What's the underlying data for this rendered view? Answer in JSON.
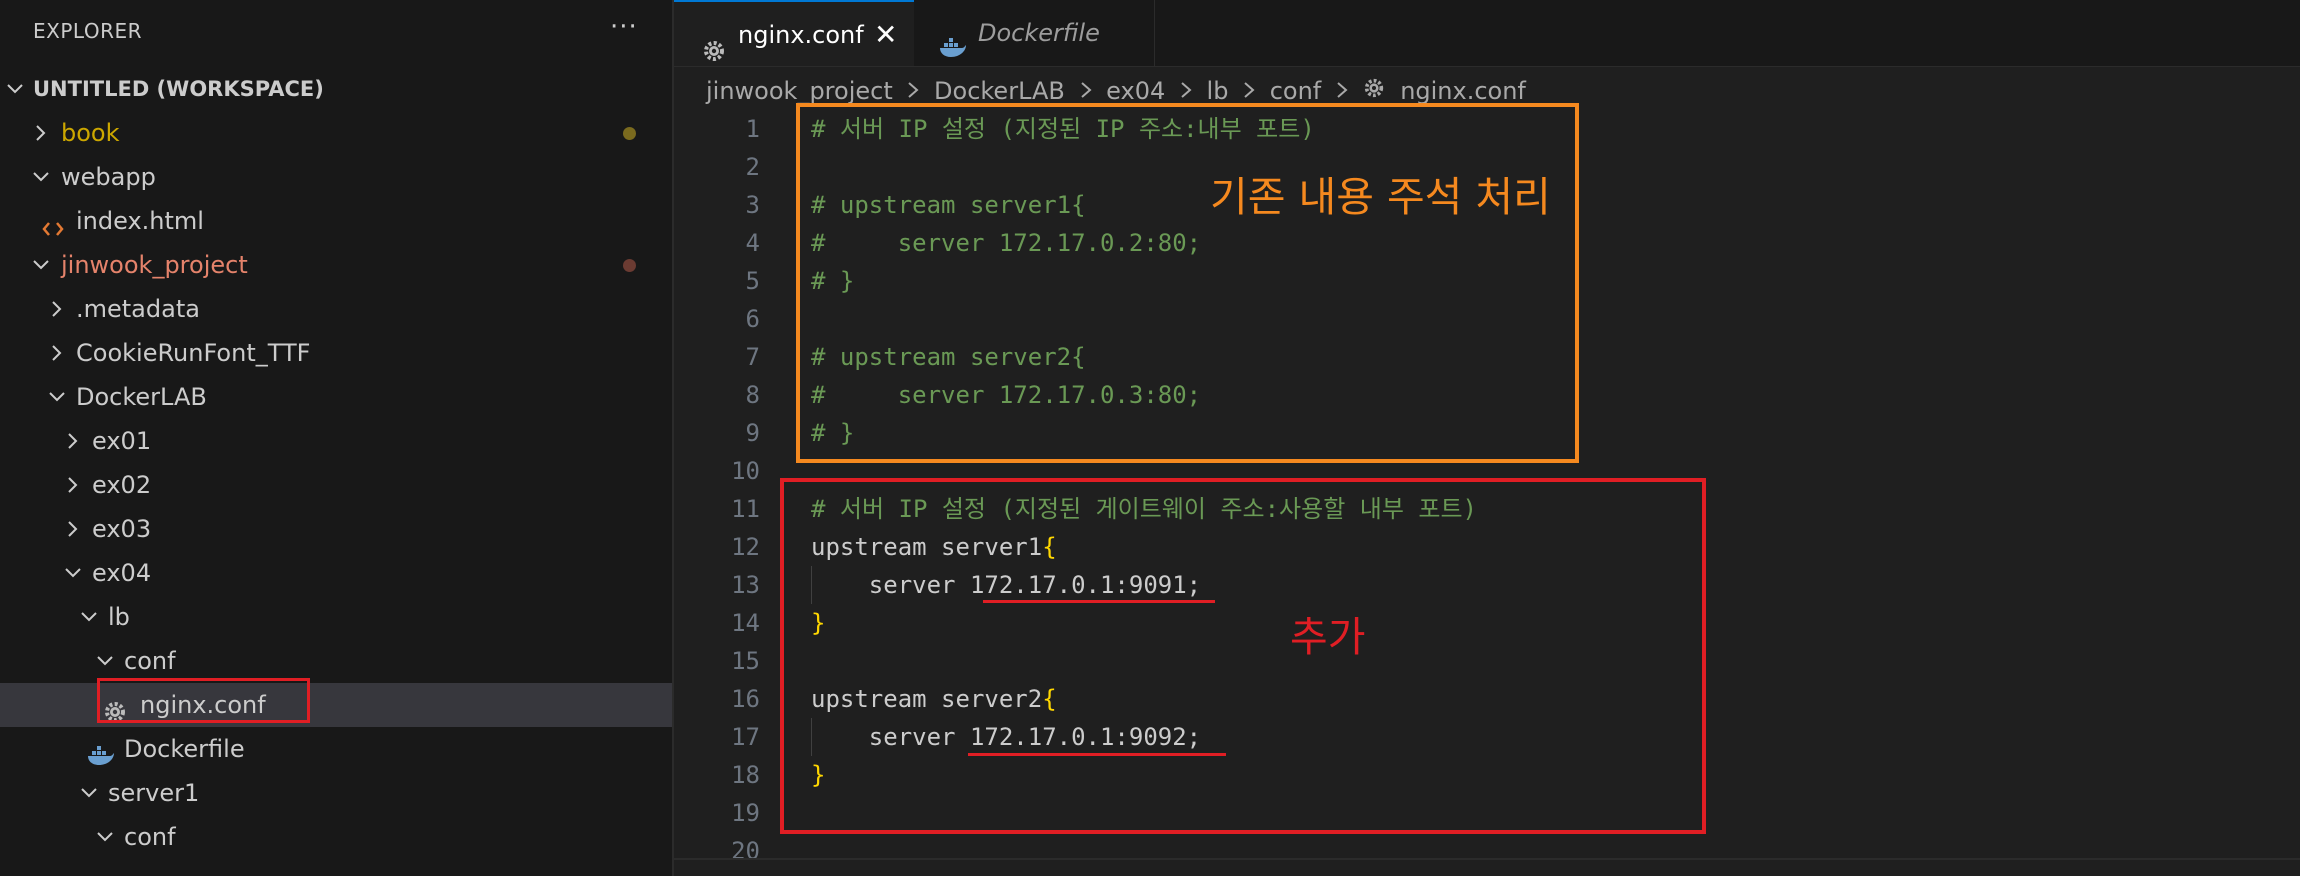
{
  "sidebar": {
    "title": "EXPLORER",
    "more_label": "···",
    "workspace": "UNTITLED (WORKSPACE)",
    "items": [
      {
        "label": "book",
        "color": "#cca700",
        "chevron": "right",
        "icon": "",
        "modified": true
      },
      {
        "label": "webapp",
        "color": "#cccccc",
        "chevron": "down",
        "icon": "",
        "modified": false
      },
      {
        "label": "index.html",
        "color": "#cccccc",
        "chevron": "",
        "icon": "html-icon",
        "modified": false
      },
      {
        "label": "jinwook_project",
        "color": "#e5836b",
        "chevron": "down",
        "icon": "",
        "modified": true
      },
      {
        "label": ".metadata",
        "color": "#cccccc",
        "chevron": "right",
        "icon": "",
        "modified": false
      },
      {
        "label": "CookieRunFont_TTF",
        "color": "#cccccc",
        "chevron": "right",
        "icon": "",
        "modified": false
      },
      {
        "label": "DockerLAB",
        "color": "#cccccc",
        "chevron": "down",
        "icon": "",
        "modified": false
      },
      {
        "label": "ex01",
        "color": "#cccccc",
        "chevron": "right",
        "icon": "",
        "modified": false
      },
      {
        "label": "ex02",
        "color": "#cccccc",
        "chevron": "right",
        "icon": "",
        "modified": false
      },
      {
        "label": "ex03",
        "color": "#cccccc",
        "chevron": "right",
        "icon": "",
        "modified": false
      },
      {
        "label": "ex04",
        "color": "#cccccc",
        "chevron": "down",
        "icon": "",
        "modified": false
      },
      {
        "label": "lb",
        "color": "#cccccc",
        "chevron": "down",
        "icon": "",
        "modified": false
      },
      {
        "label": "conf",
        "color": "#cccccc",
        "chevron": "down",
        "icon": "",
        "modified": false
      },
      {
        "label": "nginx.conf",
        "color": "#cccccc",
        "chevron": "",
        "icon": "gear-icon",
        "modified": false,
        "selected": true
      },
      {
        "label": "Dockerfile",
        "color": "#cccccc",
        "chevron": "",
        "icon": "docker-icon",
        "modified": false
      },
      {
        "label": "server1",
        "color": "#cccccc",
        "chevron": "down",
        "icon": "",
        "modified": false
      },
      {
        "label": "conf",
        "color": "#cccccc",
        "chevron": "down",
        "icon": "",
        "modified": false
      }
    ]
  },
  "tabs": [
    {
      "label": "nginx.conf",
      "icon": "gear-icon",
      "active": true,
      "close": "✕"
    },
    {
      "label": "Dockerfile",
      "icon": "docker-icon",
      "active": false
    }
  ],
  "breadcrumb": [
    "jinwook_project",
    "DockerLAB",
    "ex04",
    "lb",
    "conf",
    "nginx.conf"
  ],
  "editor": {
    "lines": [
      {
        "n": "1",
        "code": "# 서버 IP 설정 (지정된 IP 주소:내부 포트)"
      },
      {
        "n": "2",
        "code": ""
      },
      {
        "n": "3",
        "code": "# upstream server1{"
      },
      {
        "n": "4",
        "code": "#     server 172.17.0.2:80;"
      },
      {
        "n": "5",
        "code": "# }"
      },
      {
        "n": "6",
        "code": ""
      },
      {
        "n": "7",
        "code": "# upstream server2{"
      },
      {
        "n": "8",
        "code": "#     server 172.17.0.3:80;"
      },
      {
        "n": "9",
        "code": "# }"
      },
      {
        "n": "10",
        "code": ""
      },
      {
        "n": "11",
        "code": "# 서버 IP 설정 (지정된 게이트웨이 주소:사용할 내부 포트)"
      },
      {
        "n": "12",
        "code": "upstream server1",
        "brace": "{"
      },
      {
        "n": "13",
        "code": "    server 172.17.0.1:9091;"
      },
      {
        "n": "14",
        "code": "",
        "brace": "}"
      },
      {
        "n": "15",
        "code": ""
      },
      {
        "n": "16",
        "code": "upstream server2",
        "brace": "{"
      },
      {
        "n": "17",
        "code": "    server 172.17.0.1:9092;"
      },
      {
        "n": "18",
        "code": "",
        "brace": "}"
      },
      {
        "n": "19",
        "code": ""
      },
      {
        "n": "20",
        "code": ""
      }
    ]
  },
  "annotations": {
    "commented_out": "기존 내용 주석 처리",
    "added": "추가"
  },
  "colors": {
    "comment": "#6a9955",
    "bracket": "#ffd700",
    "orange_box": "#f5891f",
    "red_box": "#e01e24",
    "accent": "#0078d4"
  }
}
